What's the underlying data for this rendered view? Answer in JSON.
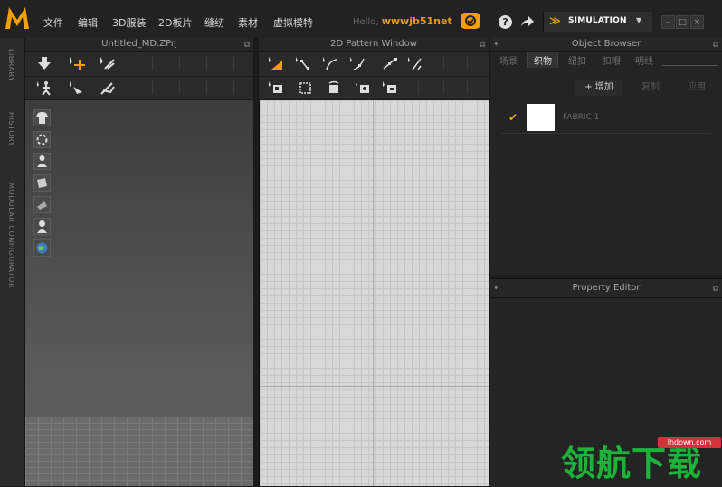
{
  "app": {
    "logo_icon": "md-logo-icon",
    "brand_color": "#f0a000"
  },
  "menu": [
    "文件",
    "编辑",
    "3D服装",
    "2D板片",
    "缝纫",
    "素材",
    "虚拟模特"
  ],
  "greeting": {
    "prefix": "Hello,",
    "user": "wwwjb51net"
  },
  "icons": {
    "cloud": "cloud-icon",
    "help": "help-icon",
    "share": "share-icon",
    "mode": "chevron-double-icon"
  },
  "help_label": "?",
  "mode": {
    "label": "SIMULATION",
    "arrow": "▼"
  },
  "window_controls": {
    "minimize": "–",
    "restore": "□",
    "close": "×"
  },
  "left_dock": {
    "tabs": [
      "LIBRARY",
      "HISTORY",
      "MODULAR CONFIGURATOR"
    ]
  },
  "windows": {
    "viewport_3d": {
      "title": "Untitled_MD.ZPrj"
    },
    "pattern_2d": {
      "title": "2D Pattern Window"
    },
    "object_browser": {
      "title": "Object Browser",
      "tabs": [
        "场景",
        "织物",
        "纽扣",
        "扣眼",
        "明线"
      ],
      "active_tab": "织物",
      "actions": {
        "add": "+ 增加",
        "copy": "复制",
        "apply": "应用"
      },
      "fabric": {
        "name": "FABRIC 1",
        "checked": "✔"
      }
    },
    "property_editor": {
      "title": "Property Editor"
    }
  },
  "watermark": {
    "site": "lhdown.com",
    "text": "领航下载"
  }
}
